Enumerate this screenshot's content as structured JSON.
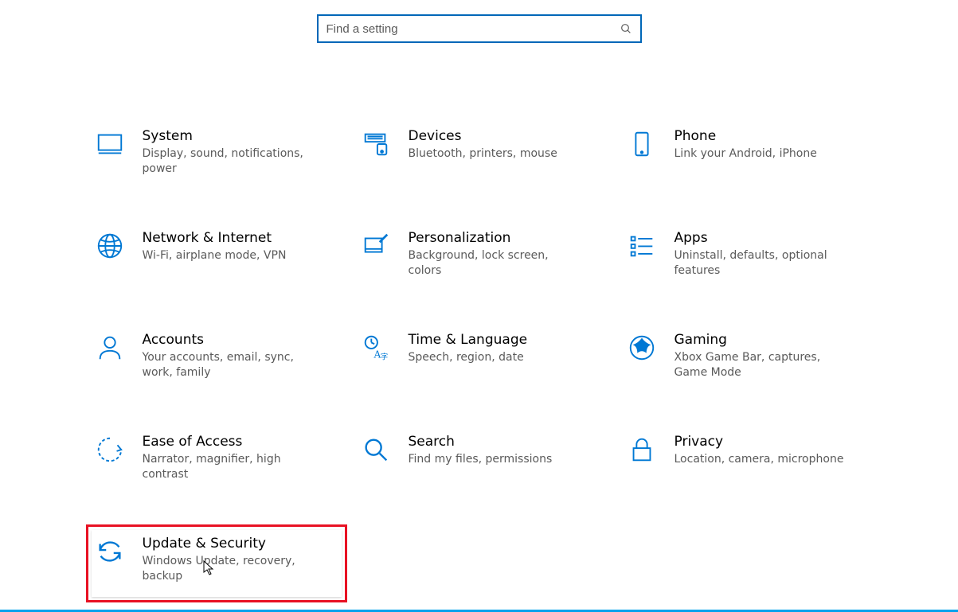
{
  "search": {
    "placeholder": "Find a setting"
  },
  "tiles": {
    "system": {
      "title": "System",
      "desc": "Display, sound, notifications, power"
    },
    "devices": {
      "title": "Devices",
      "desc": "Bluetooth, printers, mouse"
    },
    "phone": {
      "title": "Phone",
      "desc": "Link your Android, iPhone"
    },
    "network": {
      "title": "Network & Internet",
      "desc": "Wi-Fi, airplane mode, VPN"
    },
    "personalization": {
      "title": "Personalization",
      "desc": "Background, lock screen, colors"
    },
    "apps": {
      "title": "Apps",
      "desc": "Uninstall, defaults, optional features"
    },
    "accounts": {
      "title": "Accounts",
      "desc": "Your accounts, email, sync, work, family"
    },
    "time": {
      "title": "Time & Language",
      "desc": "Speech, region, date"
    },
    "gaming": {
      "title": "Gaming",
      "desc": "Xbox Game Bar, captures, Game Mode"
    },
    "ease": {
      "title": "Ease of Access",
      "desc": "Narrator, magnifier, high contrast"
    },
    "search_cat": {
      "title": "Search",
      "desc": "Find my files, permissions"
    },
    "privacy": {
      "title": "Privacy",
      "desc": "Location, camera, microphone"
    },
    "update": {
      "title": "Update & Security",
      "desc": "Windows Update, recovery, backup"
    }
  }
}
